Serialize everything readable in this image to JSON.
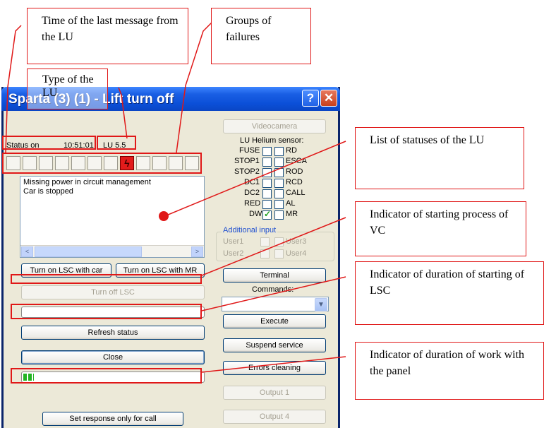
{
  "window": {
    "title": "Sparta (3) (1) - Lift turn off",
    "help_label": "?",
    "close_label": "✕",
    "status_label": "Status on",
    "time": "10:51:01",
    "lu_type": "LU 5.5",
    "log_lines": [
      "Missing power in circuit management",
      "Car is stopped"
    ],
    "btn_lsc_car": "Turn on LSC with car",
    "btn_lsc_mr": "Turn on LSC with MR",
    "btn_turn_off_lsc": "Turn off LSC",
    "btn_refresh": "Refresh status",
    "btn_close": "Close",
    "btn_set_response": "Set response only for call",
    "btn_videocamera": "Videocamera",
    "sensor_header": "LU Helium sensor:",
    "sensors_left": [
      "FUSE",
      "STOP1",
      "STOP2",
      "DC1",
      "DC2",
      "RED",
      "DW"
    ],
    "sensors_right": [
      "RD",
      "ESCA",
      "ROD",
      "RCD",
      "CALL",
      "AL",
      "MR"
    ],
    "checked_left": "DW",
    "additional_input_label": "Additional input",
    "additional_inputs": [
      "User1",
      "User3",
      "User2",
      "User4"
    ],
    "btn_terminal": "Terminal",
    "commands_label": "Commands:",
    "btn_execute": "Execute",
    "btn_suspend": "Suspend service",
    "btn_errors_cleaning": "Errors cleaning",
    "btn_output1": "Output 1",
    "btn_output4": "Output 4",
    "failure_groups_count": 12,
    "failure_active_index": 7,
    "work_progress_fraction": 0.06,
    "colors": {
      "annotation_red": "#e01818",
      "title_blue": "#0b4fd8",
      "window_bg": "#ece9d8",
      "progress_green": "#22b422"
    }
  },
  "annotations": {
    "time_of_last_message": "Time of the last message from the LU",
    "groups_of_failures": "Groups of failures",
    "type_of_lu": "Type of the LU",
    "list_of_statuses": "List of statuses of the LU",
    "indicator_vc": "Indicator of starting process of VC",
    "indicator_lsc": "Indicator of duration of starting of LSC",
    "indicator_panel": "Indicator of duration of work with the panel"
  }
}
